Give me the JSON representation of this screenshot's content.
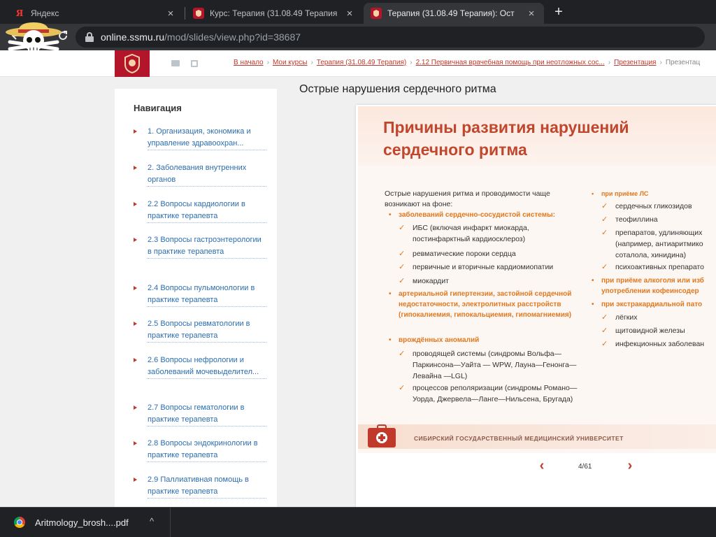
{
  "browser": {
    "tabs": [
      {
        "title": "Яндекс",
        "favicon": "yandex-icon",
        "active": false
      },
      {
        "title": "Курс: Терапия (31.08.49 Терапия",
        "favicon": "ssmu-crest-icon",
        "active": false
      },
      {
        "title": "Терапия (31.08.49 Терапия): Ост",
        "favicon": "ssmu-crest-icon",
        "active": true
      }
    ],
    "close_glyph": "×",
    "new_tab_glyph": "+",
    "url_host": "online.ssmu.ru",
    "url_path": "/mod/slides/view.php?id=38687"
  },
  "breadcrumb": [
    "В начало",
    "Мои курсы",
    "Терапия (31.08.49 Терапия)",
    "2.12 Первичная врачебная помощь при неотложных сос...",
    "Презентация",
    "Презентац"
  ],
  "breadcrumb_sep": "›",
  "navigation": {
    "title": "Навигация",
    "items": [
      "1. Организация, экономика и управление здравоохран...",
      "2. Заболевания внутренних органов",
      "2.2 Вопросы кардиологии в практике терапевта",
      "2.3 Вопросы гастроэнтерологии в практике терапевта",
      "2.4 Вопросы пульмонологии в практике терапевта",
      "2.5 Вопросы ревматологии в практике терапевта",
      "2.6 Вопросы нефрологии и заболеваний мочевыделител...",
      "2.7 Вопросы гематологии в практике терапевта",
      "2.8 Вопросы эндокринологии в практике терапевта",
      "2.9 Паллиативная помощь в практике терапевта"
    ]
  },
  "content": {
    "title": "Острые нарушения сердечного ритма"
  },
  "slide": {
    "title": "Причины развития нарушений сердечного ритма",
    "intro": "Острые нарушения ритма и проводимости чаще возникают на фоне:",
    "left_orange": [
      "заболеваний сердечно-сосудистой системы:",
      "артериальной гипертензии, застойной сердечной недостаточности, электролитных расстройств (гипокалиемия, гипокальциемия, гипомагниемия)",
      "врождённых аномалий"
    ],
    "left_checks": [
      "ИБС (включая инфаркт миокарда, постинфарктный кардиосклероз)",
      "ревматические пороки сердца",
      "первичные и вторичные кардиомиопатии",
      "миокардит",
      "проводящей системы (синдромы Вольфа—Паркинсона—Уайта — WPW, Лауна—Генонга—Левайна —LGL)",
      "процессов реполяризации (синдромы Романо—Уорда, Джервела—Ланге—Нильсена, Бругада)"
    ],
    "right_orange": [
      "при приёме ЛС",
      "при приёме алкоголя или изб употреблении кофеинсодер",
      "при экстракардиальной пато"
    ],
    "right_checks": [
      "сердечных гликозидов",
      "теофиллина",
      "препаратов, удлиняющих (например, антиаритмико соталола, хинидина)",
      "психоактивных препарато",
      "лёгких",
      "щитовидной железы",
      "инфекционных заболеван"
    ],
    "footer": "Сибирский государственный медицинский университет"
  },
  "pager": {
    "label": "4/61",
    "prev_glyph": "‹",
    "next_glyph": "›"
  },
  "downloads": {
    "filename": "Aritmology_brosh....pdf",
    "chevron": "^"
  },
  "colors": {
    "accent_red": "#c0392b",
    "orange": "#e0781f",
    "link_blue": "#2a6db0"
  }
}
